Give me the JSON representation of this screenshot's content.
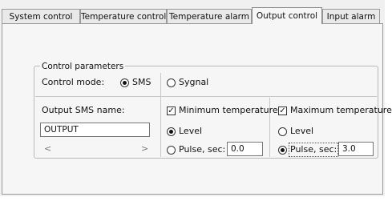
{
  "tabs": [
    {
      "label": "System control"
    },
    {
      "label": "Temperature control"
    },
    {
      "label": "Temperature alarm"
    },
    {
      "label": "Output control",
      "active": true
    },
    {
      "label": "Input alarm"
    }
  ],
  "group": {
    "title": "Control parameters",
    "control_mode_label": "Control mode:",
    "mode_sms_label": "SMS",
    "mode_signal_label": "Sygnal",
    "mode_selected": "SMS",
    "sms_name_label": "Output SMS name:",
    "sms_name_value": "OUTPUT",
    "scroll_left": "<",
    "scroll_right": ">",
    "min": {
      "checkbox_label": "Minimum temperature",
      "checked": true,
      "level_label": "Level",
      "pulse_label": "Pulse, sec:",
      "selected": "Level",
      "pulse_value": "0.0"
    },
    "max": {
      "checkbox_label": "Maximum temperature",
      "checked": true,
      "level_label": "Level",
      "pulse_label": "Pulse, sec:",
      "selected": "Pulse",
      "pulse_value": "3.0"
    }
  }
}
